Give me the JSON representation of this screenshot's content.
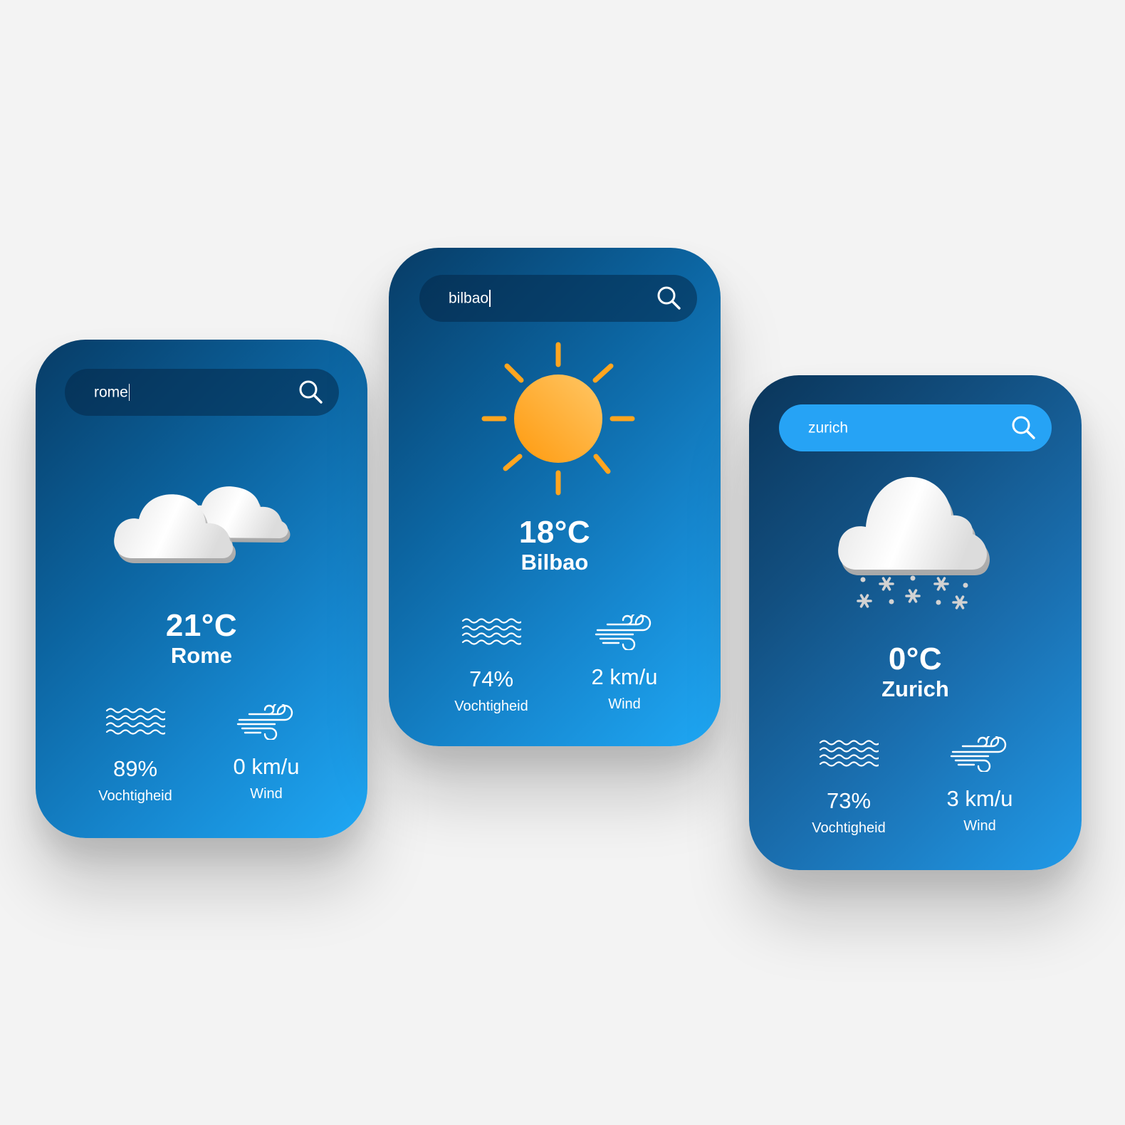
{
  "colors": {
    "page_background": "#f3f3f3",
    "card_gradient_dark": "#073c66",
    "card_gradient_light": "#1fa8f5",
    "active_search": "#26a3f5",
    "sun": "#ffa51f",
    "text": "#ffffff"
  },
  "cards": [
    {
      "search": {
        "value": "rome",
        "has_caret": true
      },
      "icon": "cloud-icon",
      "temperature": "21°C",
      "city": "Rome",
      "humidity": {
        "value": "89%",
        "label": "Vochtigheid",
        "icon": "humidity-waves-icon"
      },
      "wind": {
        "value": "0 km/u",
        "label": "Wind",
        "icon": "wind-icon"
      }
    },
    {
      "search": {
        "value": "bilbao",
        "has_caret": true
      },
      "icon": "sun-icon",
      "temperature": "18°C",
      "city": "Bilbao",
      "humidity": {
        "value": "74%",
        "label": "Vochtigheid",
        "icon": "humidity-waves-icon"
      },
      "wind": {
        "value": "2 km/u",
        "label": "Wind",
        "icon": "wind-icon"
      }
    },
    {
      "search": {
        "value": "zurich",
        "has_caret": false
      },
      "icon": "snow-cloud-icon",
      "temperature": "0°C",
      "city": "Zurich",
      "humidity": {
        "value": "73%",
        "label": "Vochtigheid",
        "icon": "humidity-waves-icon"
      },
      "wind": {
        "value": "3 km/u",
        "label": "Wind",
        "icon": "wind-icon"
      }
    }
  ]
}
